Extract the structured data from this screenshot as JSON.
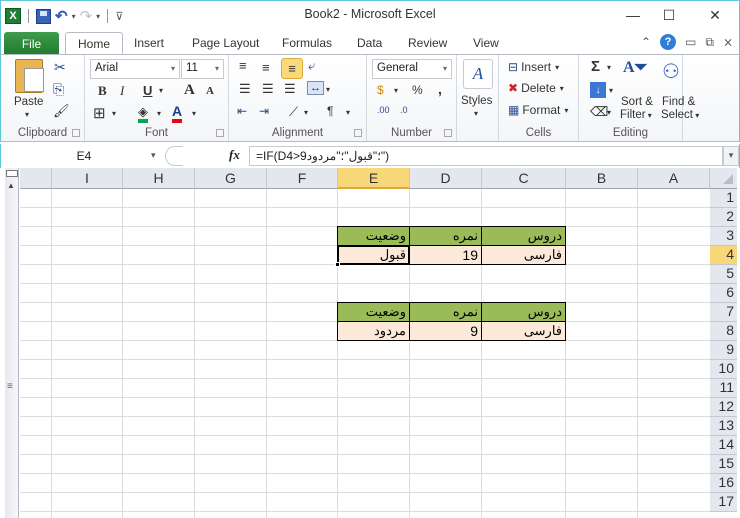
{
  "window": {
    "title": "Book2  -  Microsoft Excel",
    "minimize_label": "—",
    "maximize_label": "☐",
    "close_label": "✕"
  },
  "quick_access": {
    "app_icon": "excel-logo-icon",
    "app_letter": "X",
    "save_icon": "save-icon",
    "undo_icon": "undo-icon",
    "redo_icon": "redo-icon",
    "customize_icon": "customize-qat-icon",
    "undo_glyph": "↶",
    "redo_glyph": "↷",
    "dropdown_glyph": "▾",
    "customize_glyph": "⊽"
  },
  "tabs": {
    "file": "File",
    "items": [
      {
        "label": "Home",
        "active": true
      },
      {
        "label": "Insert",
        "active": false
      },
      {
        "label": "Page Layout",
        "active": false
      },
      {
        "label": "Formulas",
        "active": false
      },
      {
        "label": "Data",
        "active": false
      },
      {
        "label": "Review",
        "active": false
      },
      {
        "label": "View",
        "active": false
      }
    ],
    "right_icons": {
      "minimize_ribbon": "⌃",
      "help": "?",
      "doc_minimize": "▭",
      "doc_restore": "⧉",
      "doc_close": "⨯"
    }
  },
  "ribbon": {
    "clipboard": {
      "label": "Clipboard",
      "paste": "Paste",
      "cut_icon": "✂",
      "copy_icon": "⎘",
      "format_painter_icon": "🖌"
    },
    "font": {
      "label": "Font",
      "font_name": "Arial",
      "font_size": "11",
      "bold": "B",
      "italic": "I",
      "underline": "U",
      "grow": "A",
      "shrink": "A",
      "borders_icon": "⊞",
      "fill_color": "#00a651",
      "font_color": "#e30613",
      "font_color_letter": "A"
    },
    "alignment": {
      "label": "Alignment",
      "wrap_icon": "⤶",
      "merge_icon": "↔",
      "orientation_icon": "⟋",
      "rtl_icon": "¶"
    },
    "number": {
      "label": "Number",
      "format": "General",
      "percent": "%",
      "comma": ",",
      "increase_decimal": ".00",
      "decrease_decimal": ".0"
    },
    "styles": {
      "label": "Styles",
      "icon_letter": "A"
    },
    "cells": {
      "label": "Cells",
      "insert": "Insert",
      "delete": "Delete",
      "format": "Format"
    },
    "editing": {
      "label": "Editing",
      "autosum": "Σ",
      "sort_filter_line1": "Sort &",
      "sort_filter_line2": "Filter",
      "find_select_line1": "Find &",
      "find_select_line2": "Select"
    }
  },
  "formula_bar": {
    "name_box": "E4",
    "fx": "fx",
    "formula": "=IF(D4>9؛\"قبول\"؛\"مردود\")"
  },
  "sheet": {
    "columns": [
      "I",
      "H",
      "G",
      "F",
      "E",
      "D",
      "C",
      "B",
      "A"
    ],
    "selected_column": "E",
    "rows": [
      "1",
      "2",
      "3",
      "4",
      "5",
      "6",
      "7",
      "8",
      "9",
      "10",
      "11",
      "12",
      "13",
      "14",
      "15",
      "16",
      "17"
    ],
    "selected_row": "4",
    "selected_cell": "E4",
    "table1": {
      "headers": {
        "C": "دروس",
        "D": "نمره",
        "E": "وضعيت"
      },
      "row4": {
        "C": "فارسی",
        "D": "19",
        "E": "قبول"
      }
    },
    "table2": {
      "headers": {
        "C": "دروس",
        "D": "نمره",
        "E": "وضعيت"
      },
      "row8": {
        "C": "فارسی",
        "D": "9",
        "E": "مردود"
      }
    },
    "header_fill": "#9bbb59",
    "data_fill": "#fde9d9"
  }
}
